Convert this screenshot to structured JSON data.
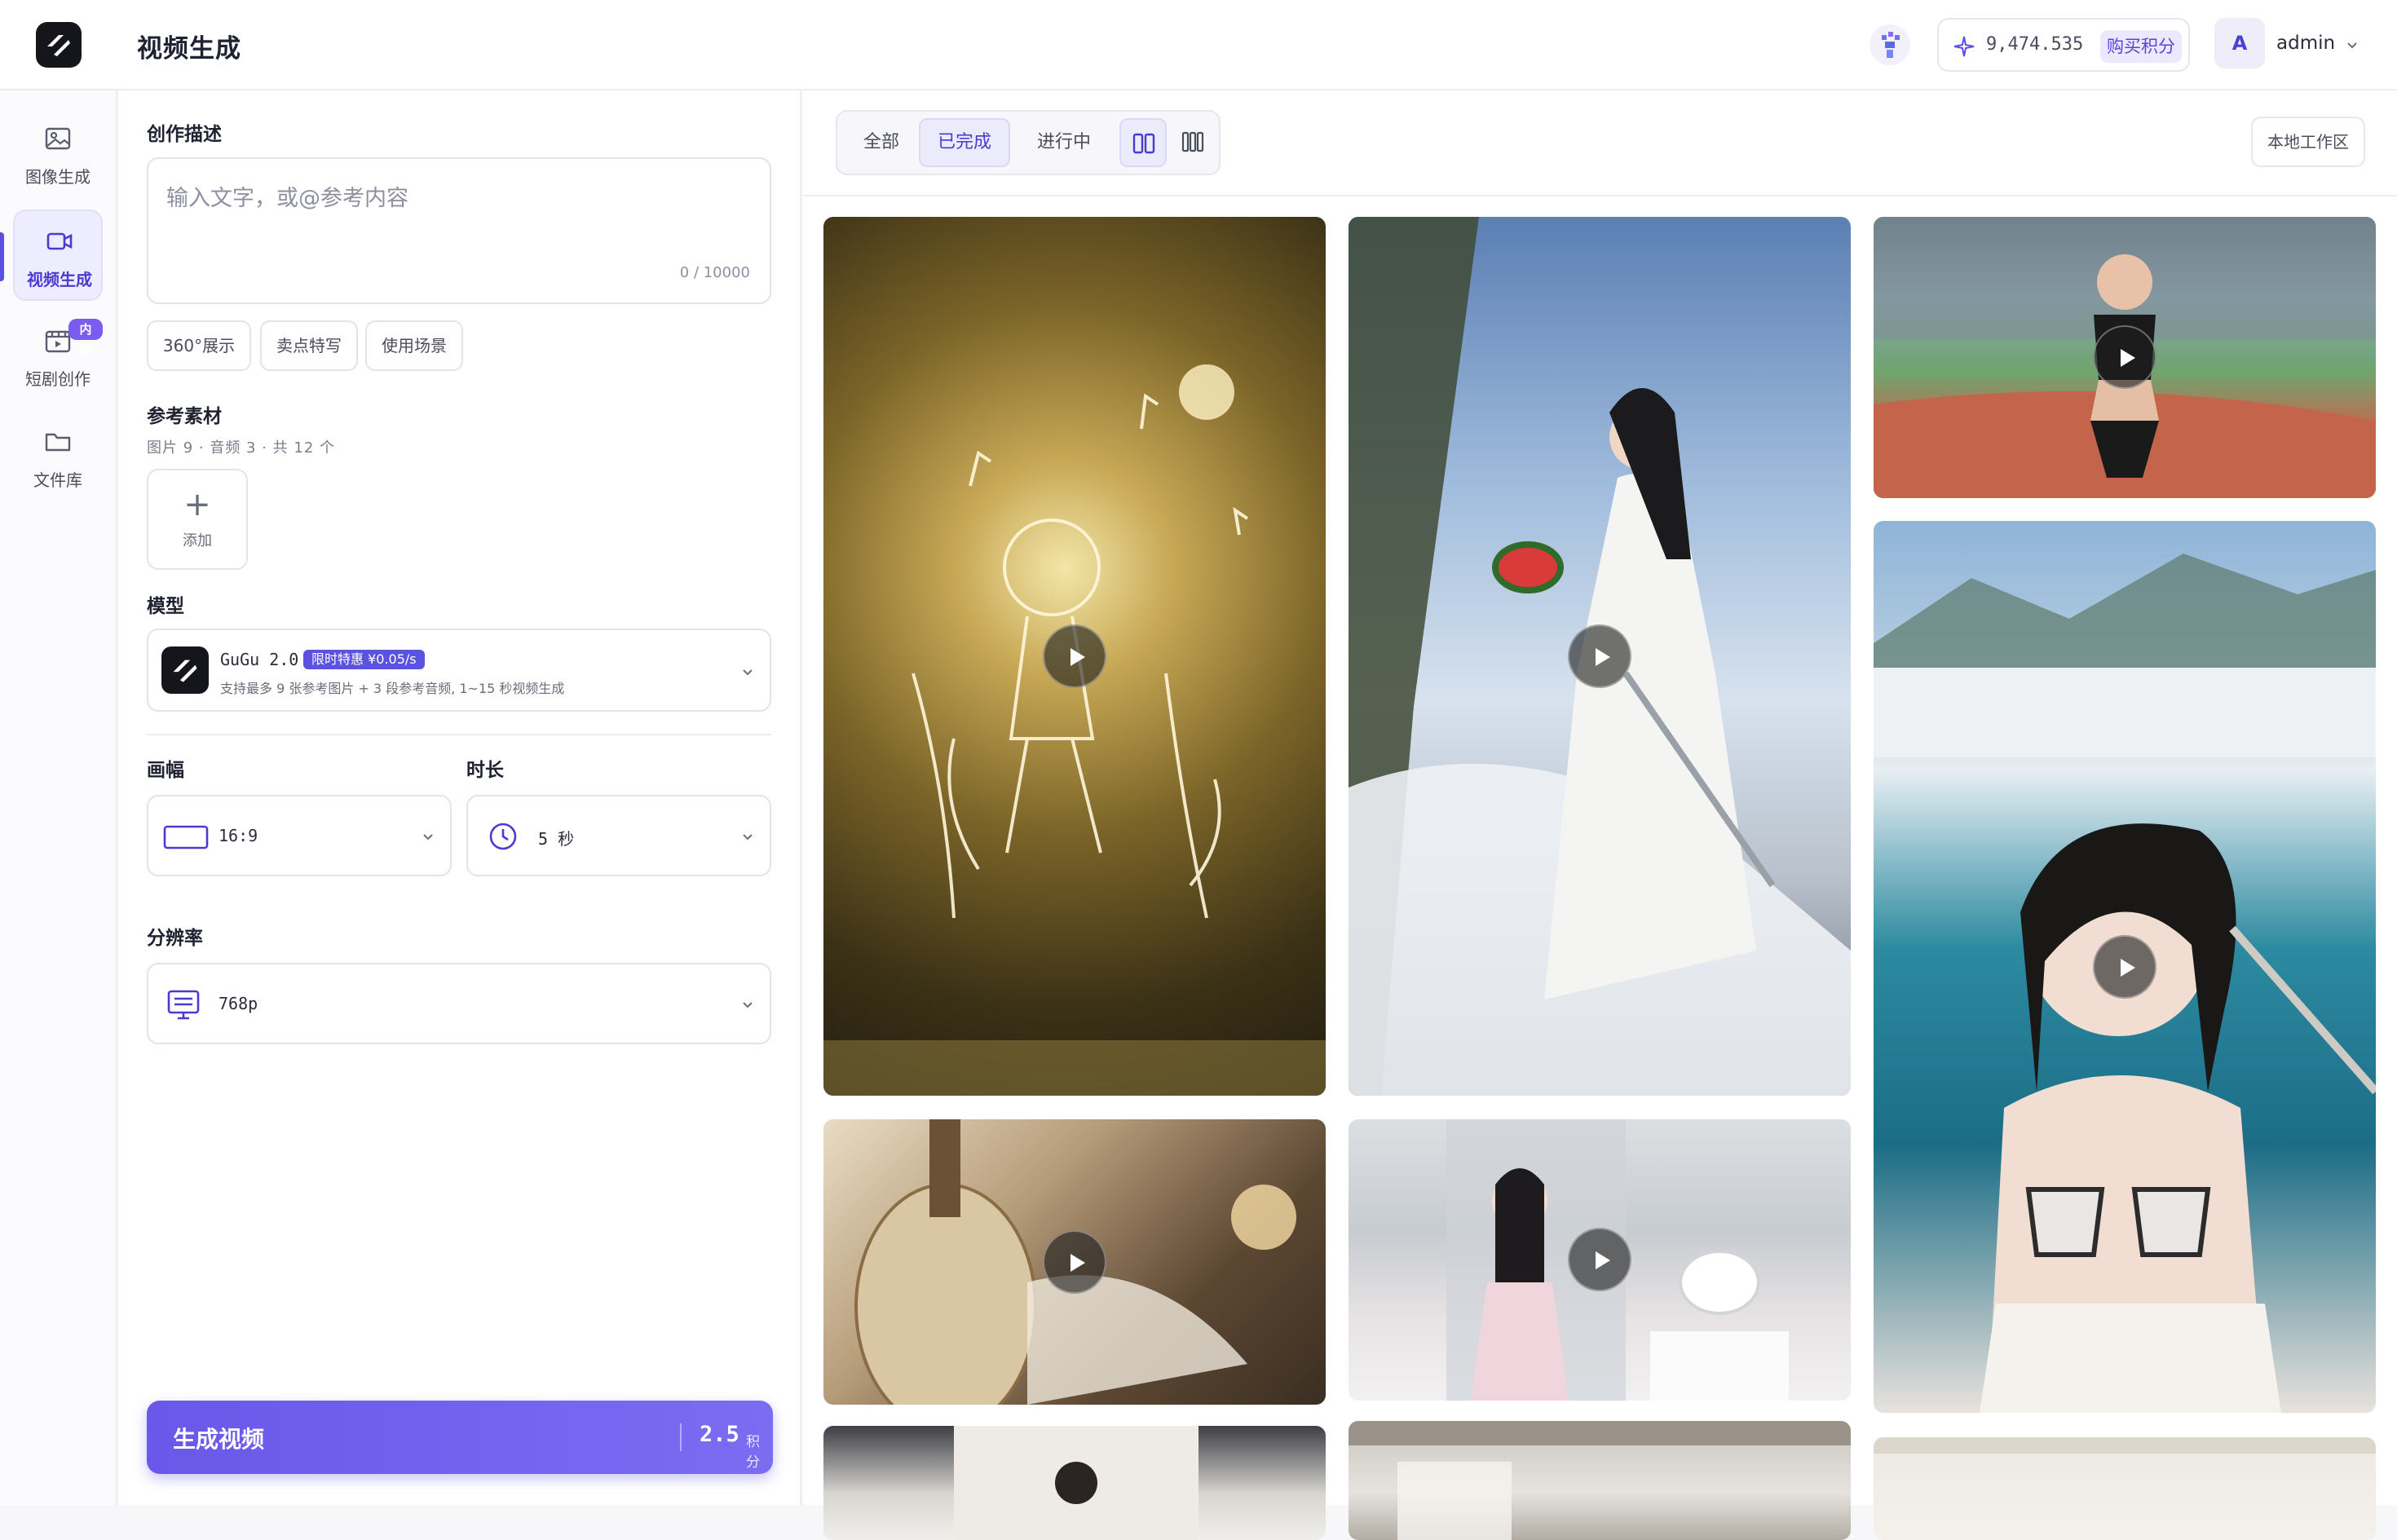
{
  "header": {
    "title": "视频生成",
    "credits": "9,474.535",
    "buy_label": "购买积分",
    "user_initial": "A",
    "user_name": "admin"
  },
  "nav": {
    "items": [
      {
        "label": "图像生成",
        "icon": "image-icon",
        "active": false
      },
      {
        "label": "视频生成",
        "icon": "video-icon",
        "active": true
      },
      {
        "label": "短剧创作",
        "icon": "film-icon",
        "active": false,
        "badge": "内测"
      },
      {
        "label": "文件库",
        "icon": "folder-icon",
        "active": false
      }
    ]
  },
  "form": {
    "desc_title": "创作描述",
    "desc_placeholder": "输入文字，或@参考内容",
    "desc_count": "0 / 10000",
    "chips": [
      "360°展示",
      "卖点特写",
      "使用场景"
    ],
    "ref_title": "参考素材",
    "ref_meta": "图片 9 · 音频 3 · 共 12 个",
    "add_label": "添加",
    "model_title": "模型",
    "model_name": "GuGu 2.0",
    "model_promo": "限时特惠 ¥0.05/s",
    "model_desc": "支持最多 9 张参考图片 + 3 段参考音频, 1~15 秒视频生成",
    "ratio_title": "画幅",
    "ratio_value": "16:9",
    "duration_title": "时长",
    "duration_value": "5 秒",
    "resolution_title": "分辨率",
    "resolution_value": "768p",
    "generate_label": "生成视频",
    "generate_cost": "2.5",
    "generate_unit": "积分"
  },
  "gallery": {
    "tabs": [
      "全部",
      "已完成",
      "进行中"
    ],
    "active_tab": "已完成",
    "local_workspace": "本地工作区",
    "view_modes": [
      "two-column-icon",
      "three-column-icon"
    ],
    "active_view": "two-column-icon",
    "cards": [
      {
        "name": "video-card-glowing-sketch"
      },
      {
        "name": "video-card-cliff-watermelon"
      },
      {
        "name": "video-card-stadium-runner"
      },
      {
        "name": "video-card-yacht-harbor"
      },
      {
        "name": "video-card-pipa-player"
      },
      {
        "name": "video-card-drone-woman"
      },
      {
        "name": "video-card-row3-left"
      },
      {
        "name": "video-card-row3-middle"
      },
      {
        "name": "video-card-row3-right"
      }
    ]
  },
  "colors": {
    "accent": "#5b4ee3",
    "accent_light": "#ecebfb",
    "border": "#e3e4eb"
  }
}
